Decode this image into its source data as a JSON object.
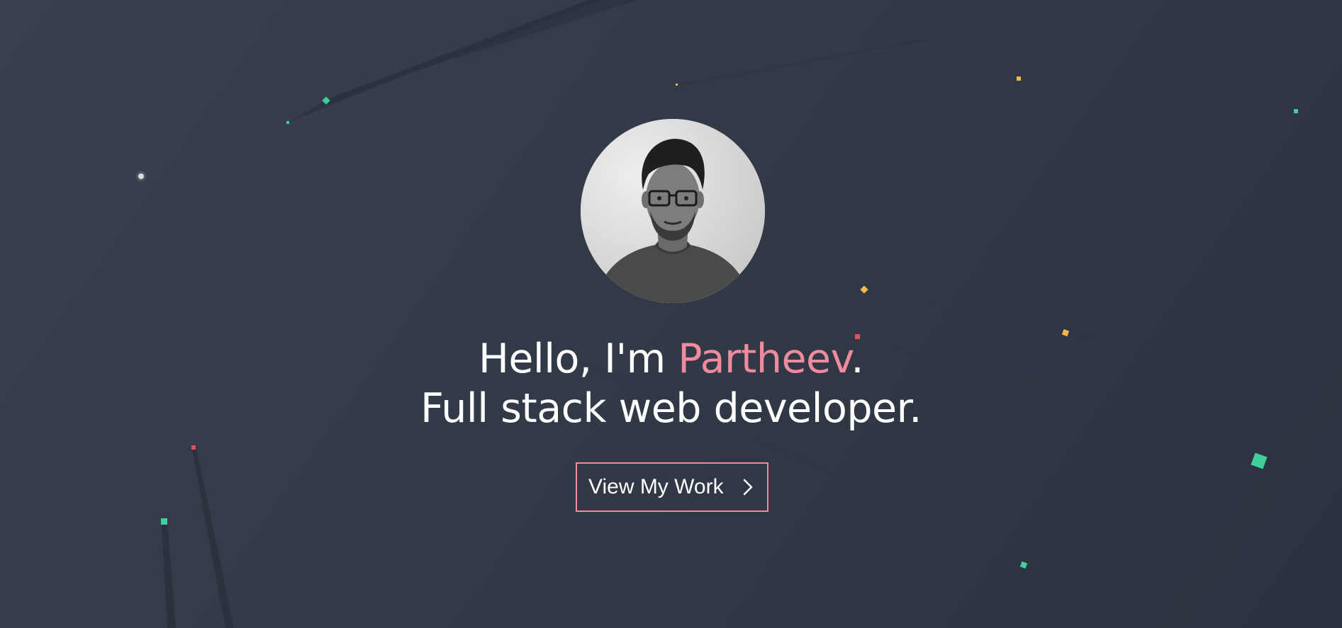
{
  "hero": {
    "greeting": "Hello, I'm ",
    "name": "Partheev",
    "name_suffix": ".",
    "tagline": "Full stack web developer.",
    "cta_label": "View My Work",
    "cta_icon": "chevron-right-icon"
  },
  "avatar": {
    "alt": "Portrait photo of Partheev"
  },
  "colors": {
    "background": "#343b49",
    "accent": "#f08a9d",
    "text": "#ffffff",
    "particle_green": "#3ecf9a",
    "particle_yellow": "#f2b84b",
    "particle_red": "#e0505e"
  }
}
